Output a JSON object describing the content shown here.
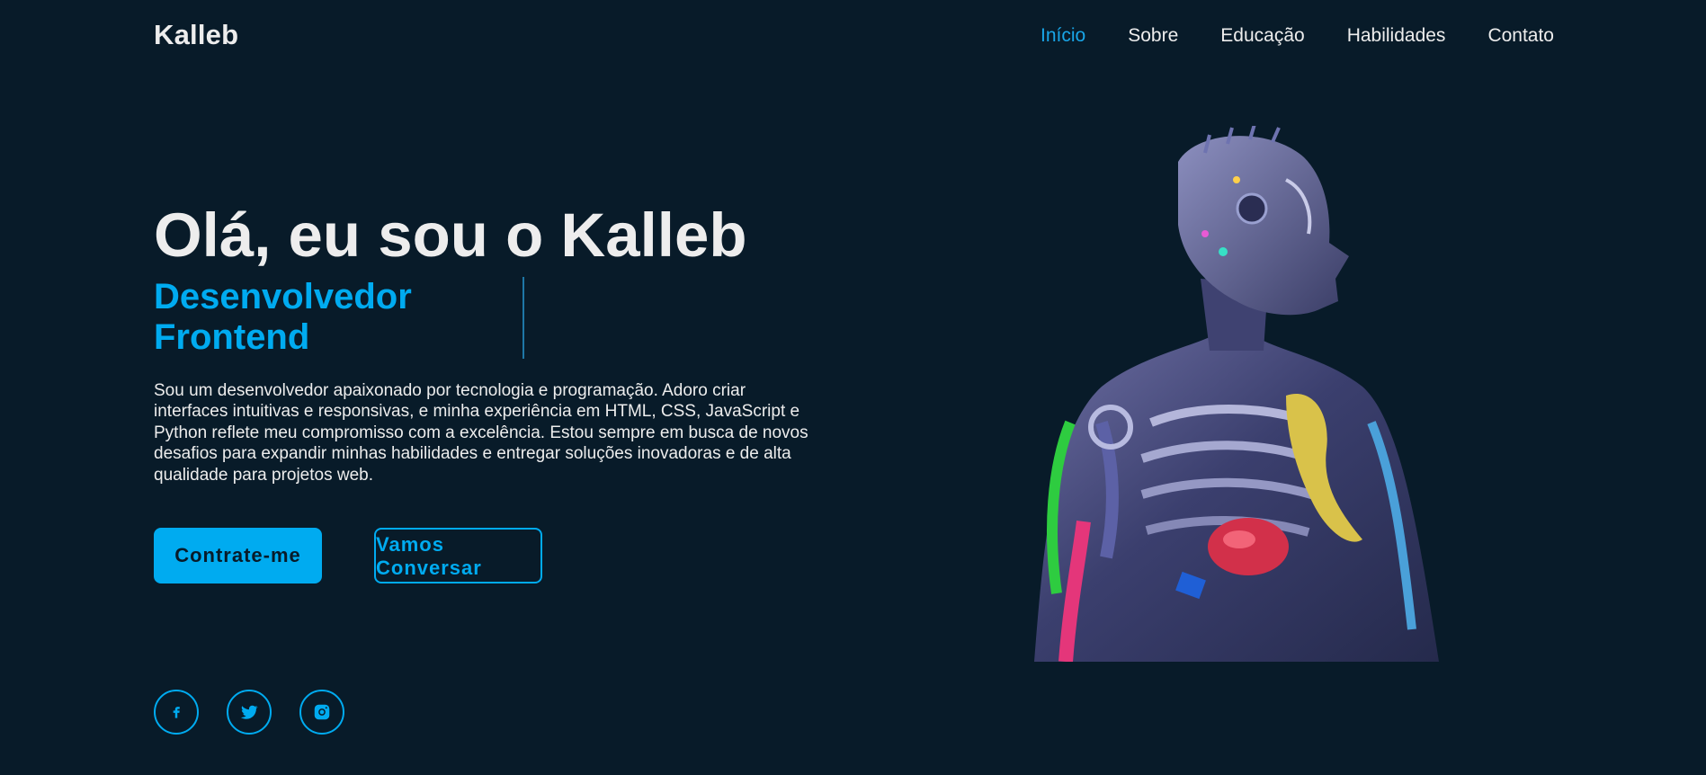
{
  "header": {
    "logo": "Kalleb",
    "nav": [
      {
        "label": "Início",
        "active": true
      },
      {
        "label": "Sobre",
        "active": false
      },
      {
        "label": "Educação",
        "active": false
      },
      {
        "label": "Habilidades",
        "active": false
      },
      {
        "label": "Contato",
        "active": false
      }
    ]
  },
  "hero": {
    "title": "Olá, eu sou o Kalleb",
    "role": "Desenvolvedor Frontend",
    "description": "Sou um desenvolvedor apaixonado por tecnologia e programação. Adoro criar interfaces intuitivas e responsivas, e minha experiência em HTML, CSS, JavaScript e Python reflete meu compromisso com a excelência. Estou sempre em busca de novos desafios para expandir minhas habilidades e entregar soluções inovadoras e de alta qualidade para projetos web.",
    "primary_button": "Contrate-me",
    "secondary_button": "Vamos Conversar"
  },
  "social": [
    {
      "icon": "facebook-icon"
    },
    {
      "icon": "twitter-icon"
    },
    {
      "icon": "instagram-icon"
    }
  ],
  "colors": {
    "background": "#081b29",
    "accent": "#00abf0",
    "text": "#ededed"
  }
}
